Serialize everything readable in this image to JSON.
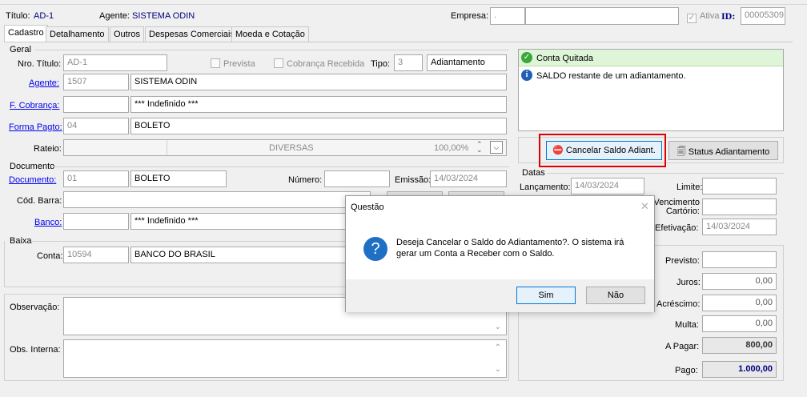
{
  "header": {
    "titulo_label": "Título:",
    "titulo_value": "AD-1",
    "agente_label": "Agente:",
    "agente_value": "SISTEMA ODIN",
    "empresa_label": "Empresa:",
    "empresa_value": ".",
    "ativa_label": "Ativa",
    "id_label": "ID:",
    "id_value": "00005309"
  },
  "tabs": [
    "Cadastro",
    "Detalhamento",
    "Outros",
    "Despesas Comerciais",
    "Moeda e Cotação"
  ],
  "geral": {
    "group_label": "Geral",
    "nro_titulo_label": "Nro. Título:",
    "nro_titulo_value": "AD-1",
    "prevista_label": "Prevista",
    "cobranca_label": "Cobrança Recebida",
    "tipo_label": "Tipo:",
    "tipo_code": "3",
    "tipo_desc": "Adiantamento",
    "agente_label": "Agente:",
    "agente_code": "1507",
    "agente_name": "SISTEMA ODIN",
    "fcobranca_label": "F. Cobrança:",
    "fcobranca_code": "",
    "fcobranca_desc": "*** Indefinido ***",
    "formapagto_label": "Forma Pagto:",
    "formapagto_code": "04",
    "formapagto_desc": "BOLETO",
    "rateio_label": "Rateio:",
    "rateio_value": "DIVERSAS",
    "rateio_pct": "100,00%"
  },
  "documento": {
    "group_label": "Documento",
    "documento_label": "Documento:",
    "documento_code": "01",
    "documento_desc": "BOLETO",
    "numero_label": "Número:",
    "numero_value": "",
    "emissao_label": "Emissão:",
    "emissao_value": "14/03/2024",
    "codbarra_label": "Cód. Barra:",
    "banco_label": "Banco:",
    "banco_code": "",
    "banco_desc": "*** Indefinido ***"
  },
  "baixa": {
    "group_label": "Baixa",
    "conta_label": "Conta:",
    "conta_code": "10594",
    "conta_desc": "BANCO DO BRASIL"
  },
  "observacao_label": "Observação:",
  "obs_interna_label": "Obs. Interna:",
  "status_panel": {
    "conta_quitada": "Conta Quitada",
    "info_text": "SALDO restante de um adiantamento."
  },
  "buttons": {
    "cancelar_saldo": "Cancelar Saldo Adiant.",
    "status_adiantamento": "Status Adiantamento"
  },
  "datas": {
    "group_label": "Datas",
    "lancamento_label": "Lançamento:",
    "lancamento_value": "14/03/2024",
    "limite_label": "Limite:",
    "limite_value": "",
    "vencimento_label": "Vencimento",
    "cartorio_label": "Cartório:",
    "vencimento_value": "",
    "efetivacao_label": "Efetivação:",
    "efetivacao_value": "14/03/2024"
  },
  "valores": {
    "previsto_label": "Previsto:",
    "previsto_value": "",
    "juros_label": "Juros:",
    "juros_value": "0,00",
    "acrescimo_label": "Acréscimo:",
    "acrescimo_value": "0,00",
    "multa_label": "Multa:",
    "multa_value": "0,00",
    "apagar_label": "A Pagar:",
    "apagar_value": "800,00",
    "pago_label": "Pago:",
    "pago_value": "1.000,00"
  },
  "dialog": {
    "title": "Questão",
    "message_line1": "Deseja Cancelar o Saldo do Adiantamento?. O sistema irá",
    "message_line2": "gerar um Conta a Receber com o Saldo.",
    "yes": "Sim",
    "no": "Não"
  },
  "colors": {
    "highlight_red": "#e00000",
    "success_green": "#dff5d8",
    "link_blue": "#0000ee"
  }
}
